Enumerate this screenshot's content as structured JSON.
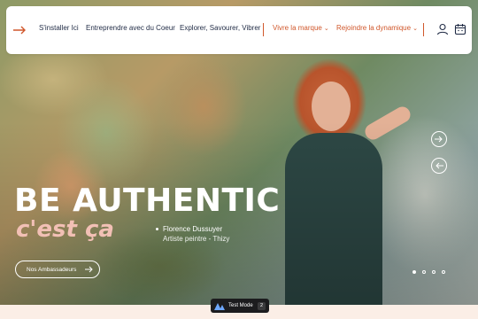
{
  "nav": {
    "links": [
      {
        "label": "S'installer Ici"
      },
      {
        "label": "Entreprendre avec du Coeur"
      },
      {
        "label": "Explorer, Savourer, Vibrer"
      },
      {
        "label": "Vivre la marque"
      },
      {
        "label": "Rejoindre la dynamique"
      }
    ],
    "accent_color": "#d0572b",
    "icons": [
      "arrow-logo-icon",
      "user-icon",
      "calendar-icon"
    ]
  },
  "hero": {
    "headline": "BE AUTHENTIC",
    "subline": "c'est ça",
    "person_name": "Florence Dussuyer",
    "person_role": "Artiste peintre - Thizy",
    "cta_label": "Nos Ambassadeurs",
    "slider": {
      "current": 1,
      "total": 4
    }
  },
  "test_mode": {
    "label": "Test Mode",
    "count": "2"
  }
}
